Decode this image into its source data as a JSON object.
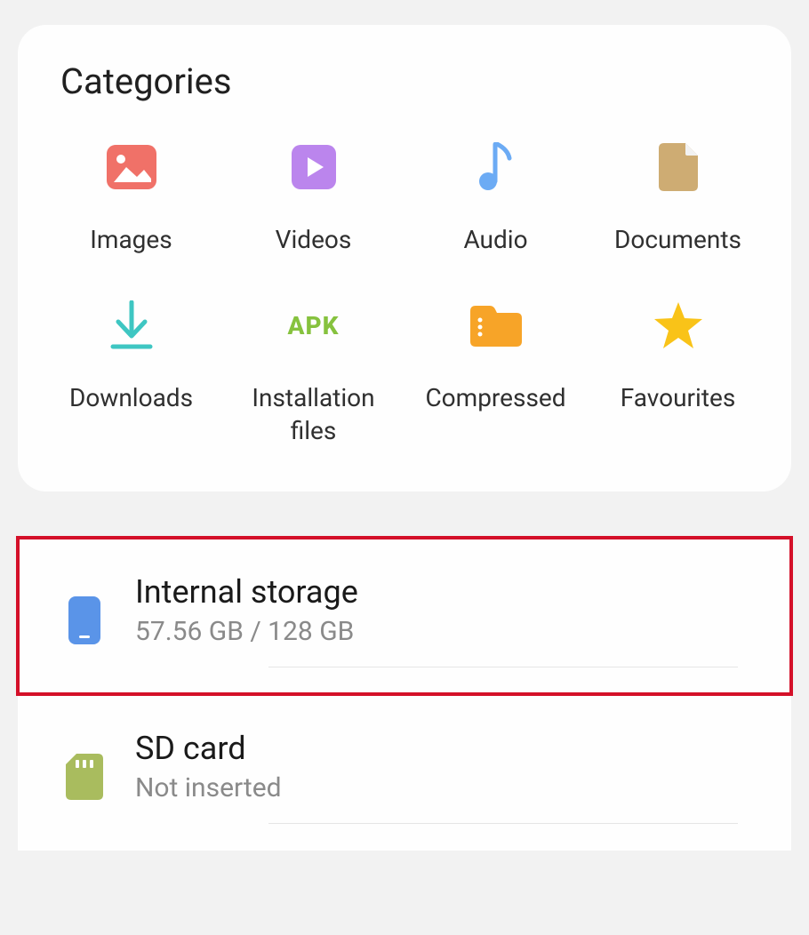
{
  "categories": {
    "title": "Categories",
    "items": [
      {
        "label": "Images",
        "icon": "image-icon"
      },
      {
        "label": "Videos",
        "icon": "video-icon"
      },
      {
        "label": "Audio",
        "icon": "audio-icon"
      },
      {
        "label": "Documents",
        "icon": "document-icon"
      },
      {
        "label": "Downloads",
        "icon": "download-icon"
      },
      {
        "label": "Installation files",
        "icon": "apk-icon"
      },
      {
        "label": "Compressed",
        "icon": "compressed-icon"
      },
      {
        "label": "Favourites",
        "icon": "star-icon"
      }
    ]
  },
  "storage": {
    "internal": {
      "title": "Internal storage",
      "subtitle": "57.56 GB / 128 GB"
    },
    "sdcard": {
      "title": "SD card",
      "subtitle": "Not inserted"
    }
  }
}
